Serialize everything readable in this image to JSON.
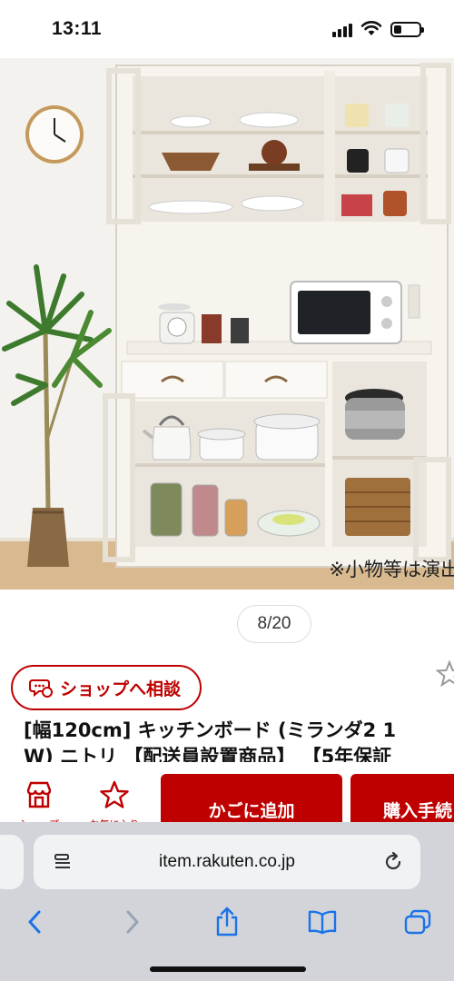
{
  "status_bar": {
    "time": "13:11",
    "battery_level": 0.3
  },
  "image": {
    "caption": "※小物等は演出",
    "icons": [
      "wall-clock",
      "potted-plant",
      "kitchen-cabinet",
      "microwave",
      "rice-cooker",
      "kettle",
      "pots",
      "storage-basket",
      "kitchen-scale"
    ]
  },
  "pagination": {
    "label": "8/20",
    "current": 8,
    "total": 20
  },
  "shop": {
    "consult_label": "ショップへ相談"
  },
  "product": {
    "title_line1": "[幅120cm] キッチンボード (ミランダ2 1",
    "title_line2": "W) ニトリ 【配送員設置商品】 【5年保証"
  },
  "actions": {
    "shop_label": "ショップ",
    "favorite_label": "お気に入り",
    "cart_label": "かごに追加",
    "buy_label": "購入手続"
  },
  "browser": {
    "url": "item.rakuten.co.jp"
  },
  "colors": {
    "accent": "#bf0000",
    "toolbar": "#d2d4da",
    "safari_blue": "#1a73e8"
  }
}
